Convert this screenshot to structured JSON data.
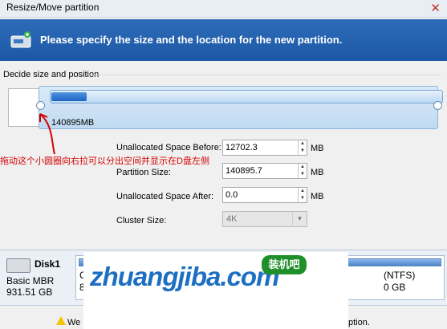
{
  "window": {
    "title": "Resize/Move partition",
    "close_glyph": "✕"
  },
  "banner": {
    "icon": "disk-resize-icon",
    "text": "Please specify the size and the location for the new partition."
  },
  "group": {
    "label": "Decide size and position"
  },
  "partition_bar": {
    "size_label": "140895MB",
    "used_fraction": 0.09
  },
  "annotation": {
    "text": "拖动这个小圆圈向右拉可以分出空间并显示在D盘左侧",
    "color": "#d40000"
  },
  "fields": {
    "before": {
      "label": "Unallocated Space Before:",
      "value": "12702.3",
      "unit": "MB"
    },
    "size": {
      "label": "Partition Size:",
      "value": "140895.7",
      "unit": "MB"
    },
    "after": {
      "label": "Unallocated Space After:",
      "value": "0.0",
      "unit": "MB"
    },
    "cluster": {
      "label": "Cluster Size:",
      "value": "4K"
    }
  },
  "disk": {
    "icon": "hard-disk-icon",
    "name": "Disk1",
    "type": "Basic MBR",
    "size": "931.51 GB",
    "part_a_top": "C",
    "part_a_bottom": "8",
    "part_b_top": "(NTFS)",
    "part_b_bottom": "0 GB"
  },
  "watermark": {
    "text": "zhuangjiba.com",
    "badge": "装机吧"
  },
  "footer": {
    "left": "We",
    "right": "ption."
  }
}
